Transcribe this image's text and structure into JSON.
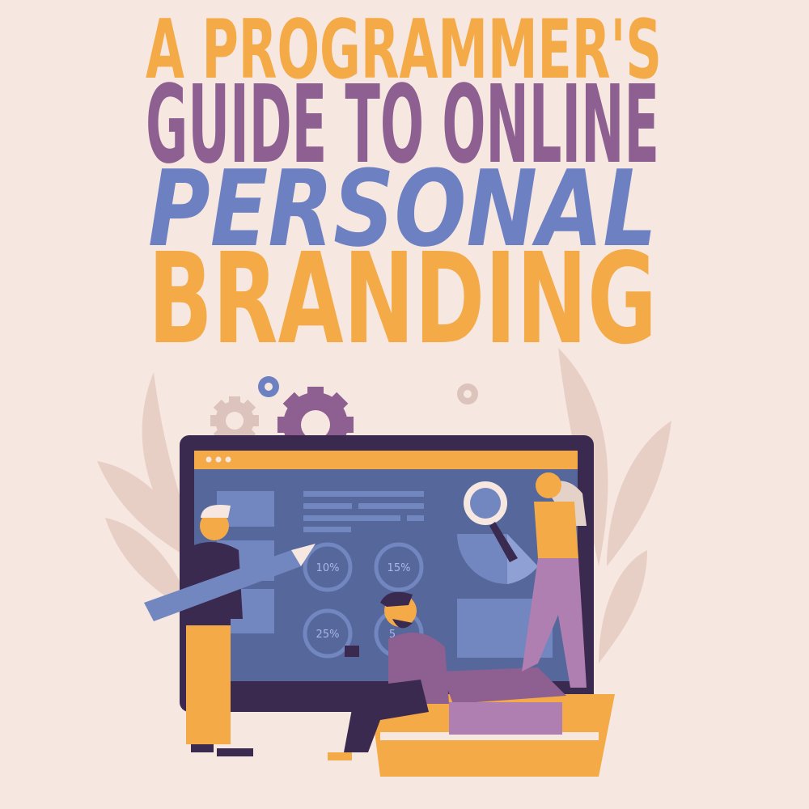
{
  "title": {
    "line1": "A PROGRAMMER'S",
    "line2": "GUIDE TO ONLINE",
    "line3": "PERSONAL",
    "line4": "BRANDING"
  },
  "illustration": {
    "screen_stats": [
      "10%",
      "15%",
      "25%",
      "5"
    ],
    "icons": [
      "gear-icon",
      "magnifier-icon",
      "pencil-icon",
      "book-icon",
      "tablet-icon"
    ]
  },
  "colors": {
    "background": "#f7e7e1",
    "orange": "#f4ab47",
    "purple": "#8e5f91",
    "blue": "#6c80c2",
    "dark": "#3b2a4f",
    "screen": "#55679b"
  }
}
